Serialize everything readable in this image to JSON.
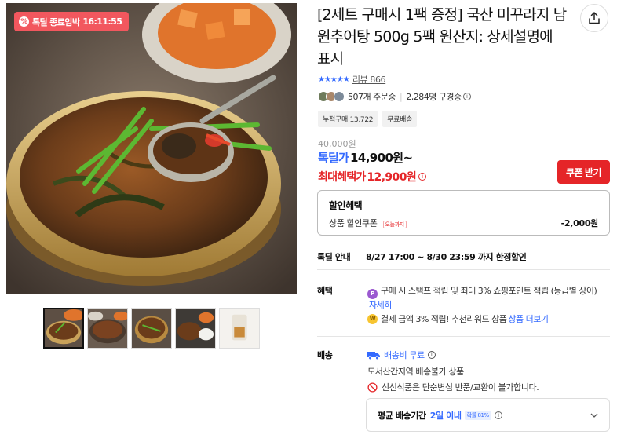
{
  "gallery": {
    "badge_icon": "%",
    "badge_text": "톡딜 종료임박",
    "badge_timer": "16:11:55",
    "thumb_count": 5,
    "active_thumb": 1
  },
  "product": {
    "title": "[2세트 구매시 1팩 증정] 국산 미꾸라지 남원추어탕 500g 5팩 원산지: 상세설명에 표시",
    "stars": "★★★★★",
    "review_label": "리뷰 866",
    "orders": "507개 주문중",
    "watchers": "2,284명 구경중",
    "chips": [
      "누적구매 13,722",
      "무료배송"
    ]
  },
  "price": {
    "original": "40,000원",
    "deal_label": "톡딜가",
    "deal_value": "14,900원~",
    "max_label": "최대혜택가",
    "max_value": "12,900원",
    "coupon_button": "쿠폰 받기"
  },
  "discount": {
    "header": "할인혜택",
    "coupon_label": "상품 할인쿠폰",
    "today_tag": "오늘까지",
    "amount": "-2,000원"
  },
  "notice": {
    "label": "톡딜 안내",
    "value": "8/27 17:00 ~ 8/30 23:59 까지 한정할인"
  },
  "benefits": {
    "label": "혜택",
    "coin1": "P",
    "text1": "구매 시 스탬프 적립 및 최대 3% 쇼핑포인트 적립 (등급별 상이)",
    "link1": "자세히",
    "coin2": "W",
    "text2": "결제 금액 3% 적립! 추천리워드 상품",
    "link2": "상품 더보기"
  },
  "shipping": {
    "label": "배송",
    "fee": "배송비 무료",
    "restriction": "도서산간지역 배송불가 상품",
    "no_return": "신선식품은 단순변심 반품/교환이 불가합니다.",
    "avg_label": "평균 배송기간",
    "avg_value": "2일 이내",
    "avg_pct": "확률 81%"
  },
  "colors": {
    "accent_blue": "#346aff",
    "accent_red": "#e52528",
    "badge_red": "#f2575e"
  }
}
